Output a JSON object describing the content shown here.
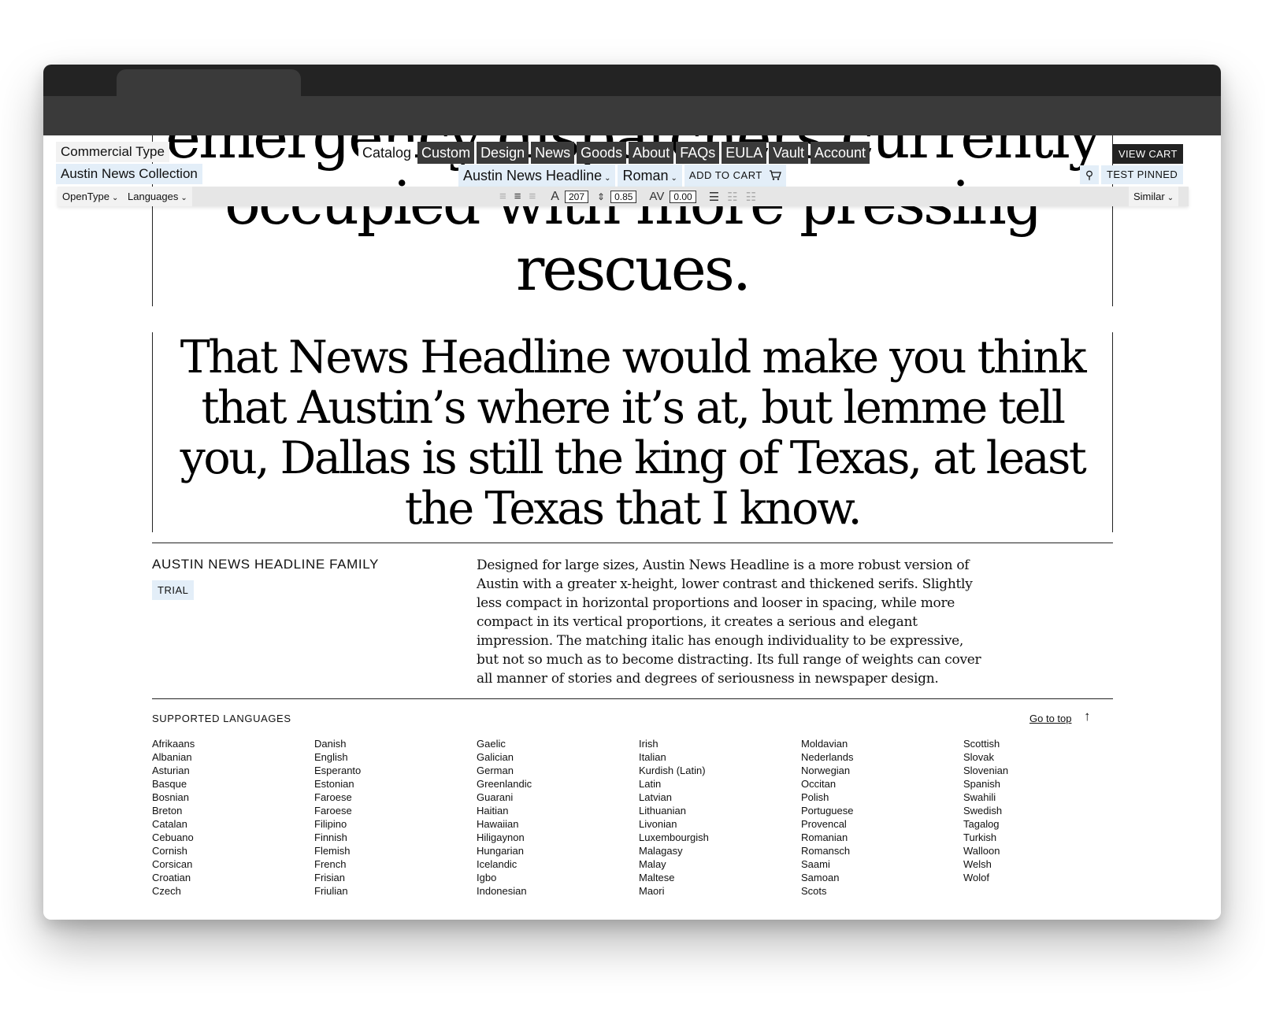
{
  "specimen_top": {
    "lines": [
      "emergency dispatchers currently",
      "occupied with more pressing",
      "rescues."
    ]
  },
  "specimen_main": {
    "text": "That News Headline would make you think that Austin’s where it’s at, but lemme tell you, Dallas is still the king of Texas, at least the Texas that I know."
  },
  "toolbar": {
    "brand": "Commercial Type",
    "collection": "Austin News Collection",
    "opentype": "OpenType",
    "languages": "Languages",
    "similar": "Similar",
    "nav": [
      "Catalog",
      "Custom",
      "Design",
      "News",
      "Goods",
      "About",
      "FAQs",
      "EULA",
      "Vault",
      "Account"
    ],
    "font_name": "Austin News Headline",
    "style": "Roman",
    "add_to_cart": "ADD TO CART",
    "view_cart": "VIEW CART",
    "test_pinned": "TEST PINNED",
    "size_value": "207",
    "leading_value": "0.85",
    "tracking_value": "0.00",
    "size_label": "A",
    "tracking_label": "AV"
  },
  "family": {
    "title": "AUSTIN NEWS HEADLINE FAMILY",
    "badge": "TRIAL",
    "description": "Designed for large sizes, Austin News Headline is a more robust version of Austin with a greater x-height, lower contrast and thickened serifs. Slightly less compact in horizontal proportions and looser in spacing, while more compact in its vertical proportions, it creates a serious and elegant impression. The matching italic has enough individuality to be expressive, but not so much as to become distracting. Its full range of weights can cover all manner of stories and degrees of seriousness in newspaper design."
  },
  "languages": {
    "title": "SUPPORTED LANGUAGES",
    "go_to_top": "Go to top",
    "columns": [
      [
        "Afrikaans",
        "Albanian",
        "Asturian",
        "Basque",
        "Bosnian",
        "Breton",
        "Catalan",
        "Cebuano",
        "Cornish",
        "Corsican",
        "Croatian",
        "Czech"
      ],
      [
        "Danish",
        "English",
        "Esperanto",
        "Estonian",
        "Faroese",
        "Faroese",
        "Filipino",
        "Finnish",
        "Flemish",
        "French",
        "Frisian",
        "Friulian"
      ],
      [
        "Gaelic",
        "Galician",
        "German",
        "Greenlandic",
        "Guarani",
        "Haitian",
        "Hawaiian",
        "Hiligaynon",
        "Hungarian",
        "Icelandic",
        "Igbo",
        "Indonesian"
      ],
      [
        "Irish",
        "Italian",
        "Kurdish (Latin)",
        "Latin",
        "Latvian",
        "Lithuanian",
        "Livonian",
        "Luxembourgish",
        "Malagasy",
        "Malay",
        "Maltese",
        "Maori"
      ],
      [
        "Moldavian",
        "Nederlands",
        "Norwegian",
        "Occitan",
        "Polish",
        "Portuguese",
        "Provencal",
        "Romanian",
        "Romansch",
        "Saami",
        "Samoan",
        "Scots"
      ],
      [
        "Scottish",
        "Slovak",
        "Slovenian",
        "Spanish",
        "Swahili",
        "Swedish",
        "Tagalog",
        "Turkish",
        "Walloon",
        "Welsh",
        "Wolof"
      ]
    ]
  },
  "icons": {
    "chevron": "chevron-down-icon",
    "cart": "cart-icon",
    "pin": "pin-icon",
    "arrow_up": "arrow-up-icon",
    "align_left": "align-left-icon",
    "align_center": "align-center-icon",
    "align_right": "align-right-icon",
    "columns": "columns-icon"
  }
}
